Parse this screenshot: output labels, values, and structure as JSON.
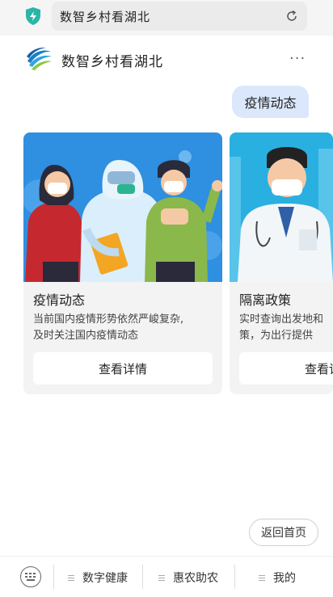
{
  "browser": {
    "url_text": "数智乡村看湖北"
  },
  "header": {
    "title": "数智乡村看湖北",
    "more": "···"
  },
  "chat": {
    "user_message": "疫情动态"
  },
  "cards": [
    {
      "title": "疫情动态",
      "desc_line1": "当前国内疫情形势依然严峻复杂,",
      "desc_line2": "及时关注国内疫情动态",
      "button": "查看详情"
    },
    {
      "title": "隔离政策",
      "desc_line1": "实时查询出发地和",
      "desc_line2": "策，为出行提供",
      "button": "查看详情"
    }
  ],
  "home_button": "返回首页",
  "bottom_nav": [
    {
      "label": "数字健康"
    },
    {
      "label": "惠农助农"
    },
    {
      "label": "我的"
    }
  ]
}
